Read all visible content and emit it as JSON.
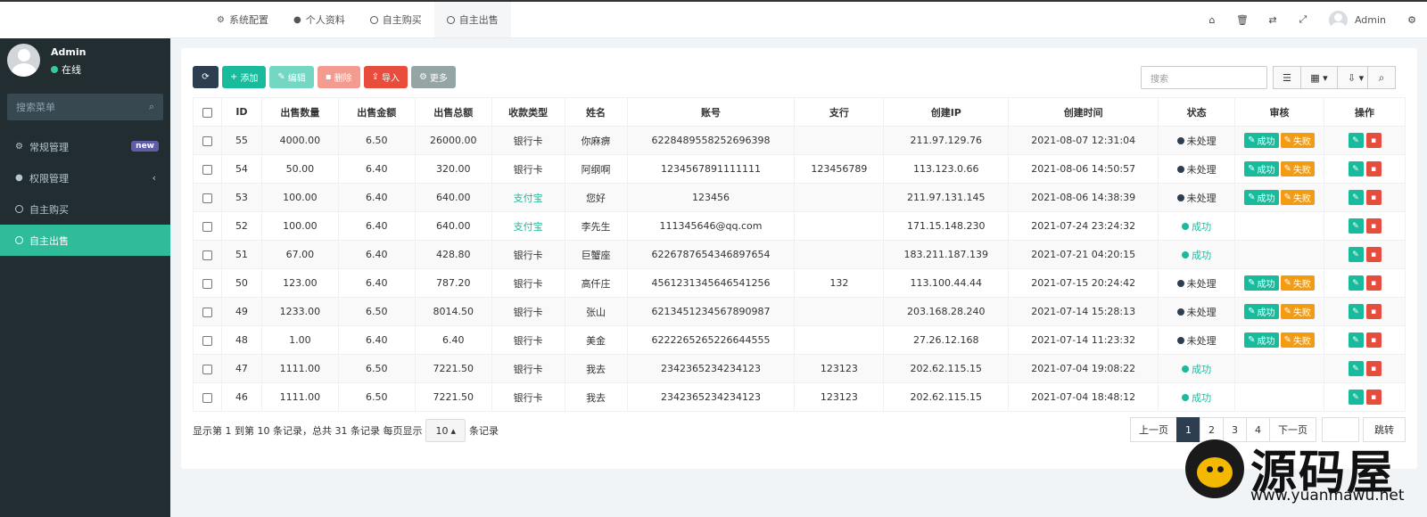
{
  "topnav": {
    "tabs": [
      {
        "icon": "gear-icon",
        "label": "系统配置"
      },
      {
        "icon": "user-icon",
        "label": "个人资料"
      },
      {
        "icon": "circle-icon",
        "label": "自主购买"
      },
      {
        "icon": "circle-icon",
        "label": "自主出售"
      }
    ],
    "active_tab": 3,
    "right_icons": [
      "home-icon",
      "trash-icon",
      "translate-icon",
      "fullscreen-icon"
    ],
    "user_name": "Admin",
    "settings_icon": "cogs-icon"
  },
  "sidebar": {
    "user": {
      "name": "Admin",
      "status": "在线"
    },
    "search_placeholder": "搜索菜单",
    "items": [
      {
        "icon": "cogs-icon",
        "label": "常规管理",
        "badge": "new"
      },
      {
        "icon": "users-icon",
        "label": "权限管理",
        "chevron": "‹"
      },
      {
        "icon": "circle-icon",
        "label": "自主购买"
      },
      {
        "icon": "circle-icon",
        "label": "自主出售",
        "active": true
      }
    ]
  },
  "toolbar": {
    "refresh": "",
    "add": "添加",
    "edit": "编辑",
    "delete": "删除",
    "import": "导入",
    "more": "更多",
    "search_placeholder": "搜索"
  },
  "table": {
    "headers": [
      "ID",
      "出售数量",
      "出售金额",
      "出售总额",
      "收款类型",
      "姓名",
      "账号",
      "支行",
      "创建IP",
      "创建时间",
      "状态",
      "审核",
      "操作"
    ],
    "rows": [
      {
        "id": "55",
        "qty": "4000.00",
        "price": "6.50",
        "total": "26000.00",
        "type": "银行卡",
        "name": "你麻痹",
        "account": "6228489558252696398",
        "branch": "",
        "ip": "211.97.129.76",
        "time": "2021-08-07 12:31:04",
        "status": "未处理",
        "audit": true
      },
      {
        "id": "54",
        "qty": "50.00",
        "price": "6.40",
        "total": "320.00",
        "type": "银行卡",
        "name": "阿纲啊",
        "account": "1234567891111111",
        "branch": "123456789",
        "ip": "113.123.0.66",
        "time": "2021-08-06 14:50:57",
        "status": "未处理",
        "audit": true
      },
      {
        "id": "53",
        "qty": "100.00",
        "price": "6.40",
        "total": "640.00",
        "type": "支付宝",
        "name": "您好",
        "account": "123456",
        "branch": "",
        "ip": "211.97.131.145",
        "time": "2021-08-06 14:38:39",
        "status": "未处理",
        "audit": true
      },
      {
        "id": "52",
        "qty": "100.00",
        "price": "6.40",
        "total": "640.00",
        "type": "支付宝",
        "name": "李先生",
        "account": "111345646@qq.com",
        "branch": "",
        "ip": "171.15.148.230",
        "time": "2021-07-24 23:24:32",
        "status": "成功",
        "audit": false
      },
      {
        "id": "51",
        "qty": "67.00",
        "price": "6.40",
        "total": "428.80",
        "type": "银行卡",
        "name": "巨蟹座",
        "account": "6226787654346897654",
        "branch": "",
        "ip": "183.211.187.139",
        "time": "2021-07-21 04:20:15",
        "status": "成功",
        "audit": false
      },
      {
        "id": "50",
        "qty": "123.00",
        "price": "6.40",
        "total": "787.20",
        "type": "银行卡",
        "name": "高仟庄",
        "account": "4561231345646541256",
        "branch": "132",
        "ip": "113.100.44.44",
        "time": "2021-07-15 20:24:42",
        "status": "未处理",
        "audit": true
      },
      {
        "id": "49",
        "qty": "1233.00",
        "price": "6.50",
        "total": "8014.50",
        "type": "银行卡",
        "name": "张山",
        "account": "6213451234567890987",
        "branch": "",
        "ip": "203.168.28.240",
        "time": "2021-07-14 15:28:13",
        "status": "未处理",
        "audit": true
      },
      {
        "id": "48",
        "qty": "1.00",
        "price": "6.40",
        "total": "6.40",
        "type": "银行卡",
        "name": "美金",
        "account": "6222265265226644555",
        "branch": "",
        "ip": "27.26.12.168",
        "time": "2021-07-14 11:23:32",
        "status": "未处理",
        "audit": true
      },
      {
        "id": "47",
        "qty": "1111.00",
        "price": "6.50",
        "total": "7221.50",
        "type": "银行卡",
        "name": "我去",
        "account": "2342365234234123",
        "branch": "123123",
        "ip": "202.62.115.15",
        "time": "2021-07-04 19:08:22",
        "status": "成功",
        "audit": false
      },
      {
        "id": "46",
        "qty": "1111.00",
        "price": "6.50",
        "total": "7221.50",
        "type": "银行卡",
        "name": "我去",
        "account": "2342365234234123",
        "branch": "123123",
        "ip": "202.62.115.15",
        "time": "2021-07-04 18:48:12",
        "status": "成功",
        "audit": false
      }
    ],
    "audit_ok": "成功",
    "audit_fail": "失败"
  },
  "pagination": {
    "info_prefix": "显示第 1 到第 10 条记录，总共 31 条记录 每页显示",
    "per_page": "10",
    "info_suffix": "条记录",
    "prev": "上一页",
    "pages": [
      "1",
      "2",
      "3",
      "4"
    ],
    "current": "1",
    "next": "下一页",
    "go": "跳转"
  },
  "watermark": {
    "text": "源码屋",
    "url": "www.yuanmawu.net"
  },
  "colors": {
    "primary_dark": "#2c3e50",
    "success": "#18bc9c",
    "danger": "#e74c3c",
    "warning": "#f39c12",
    "sidebar": "#222d32"
  }
}
